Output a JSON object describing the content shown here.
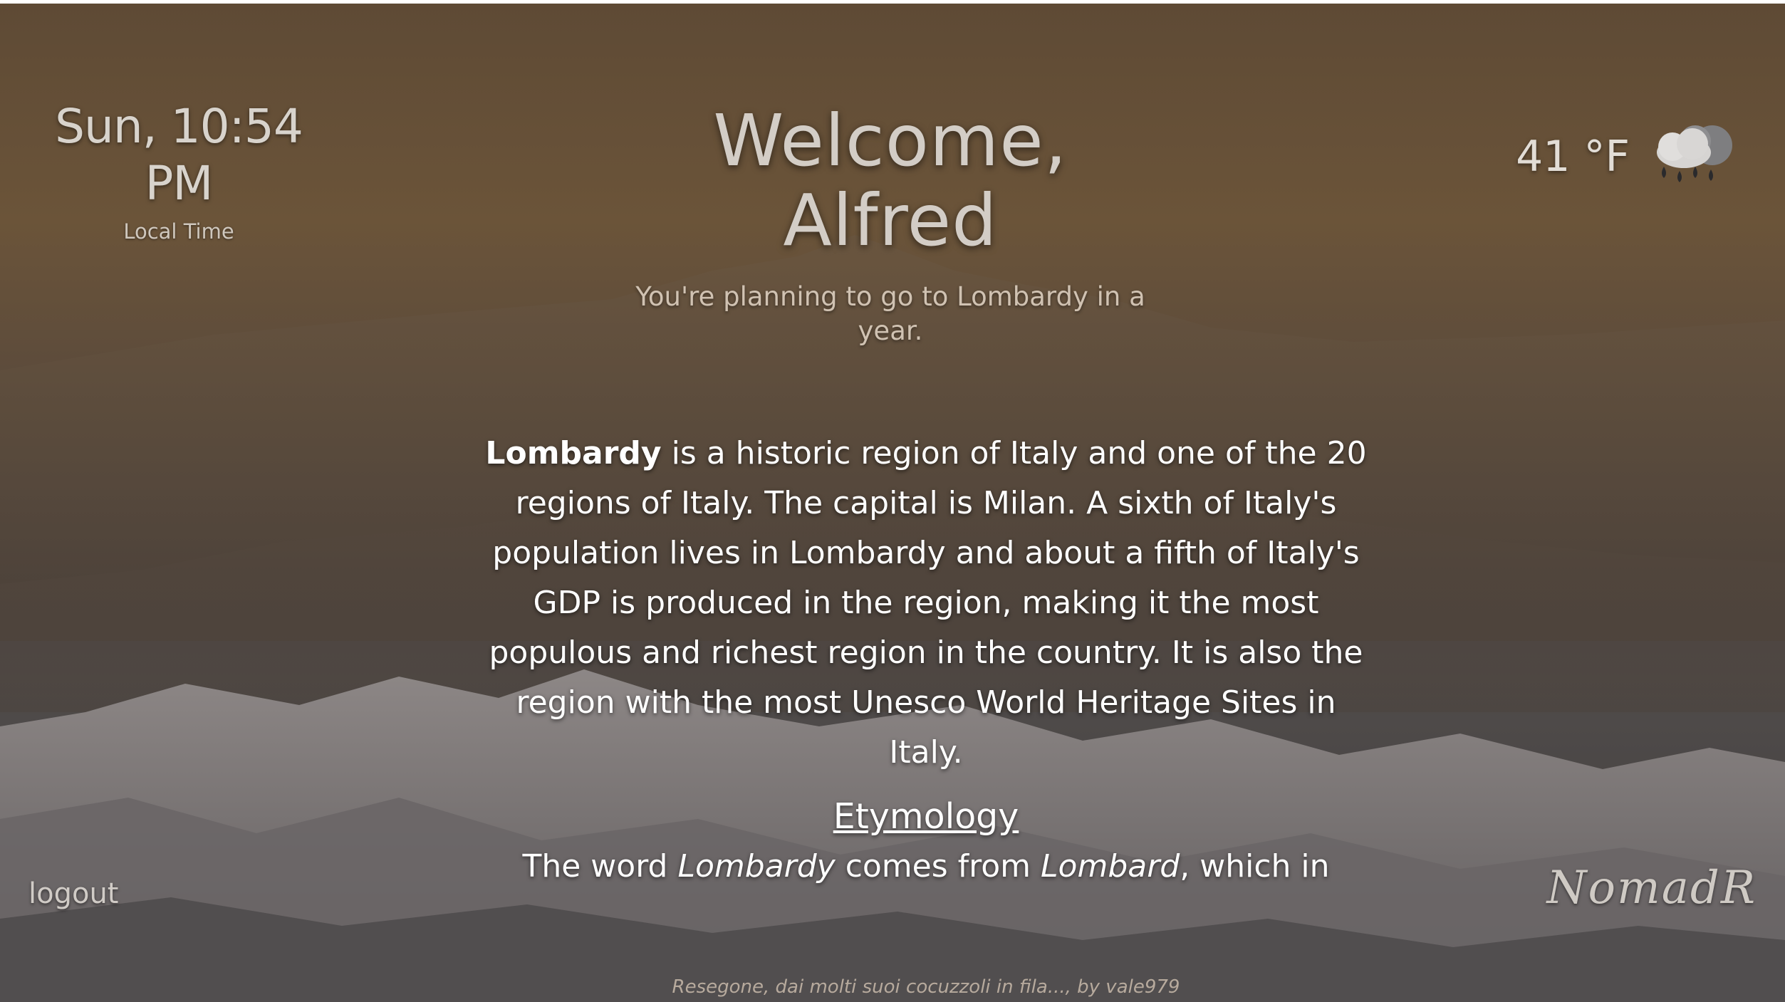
{
  "header": {
    "clock": "Sun, 10:54 PM",
    "clock_caption": "Local Time",
    "welcome_line1": "Welcome,",
    "welcome_line2": "Alfred",
    "planning": "You're planning to go to Lombardy in a year."
  },
  "weather": {
    "temperature": "41 °F",
    "icon": "rain-cloud-icon"
  },
  "article": {
    "lead_bold": "Lombardy",
    "lead_rest": " is a historic region of Italy and one of the 20 regions of Italy. The capital is Milan. A sixth of Italy's population lives in Lombardy and about a fifth of Italy's GDP is produced in the region, making it the most populous and richest region in the country. It is also the region with the most Unesco World Heritage Sites in Italy.",
    "section_title": "Etymology",
    "section_text_1": "The word ",
    "section_italic_1": "Lombardy",
    "section_text_2": " comes from ",
    "section_italic_2": "Lombard",
    "section_text_3": ", which in"
  },
  "footer": {
    "logout_label": "logout",
    "logo_text": "NomadR",
    "photo_credit": "Resegone, dai molti suoi cocuzzoli in fila..., by vale979"
  },
  "colors": {
    "sky_top": "#5e4a35",
    "snow": "#9a9594",
    "text_primary": "#ffffff"
  }
}
